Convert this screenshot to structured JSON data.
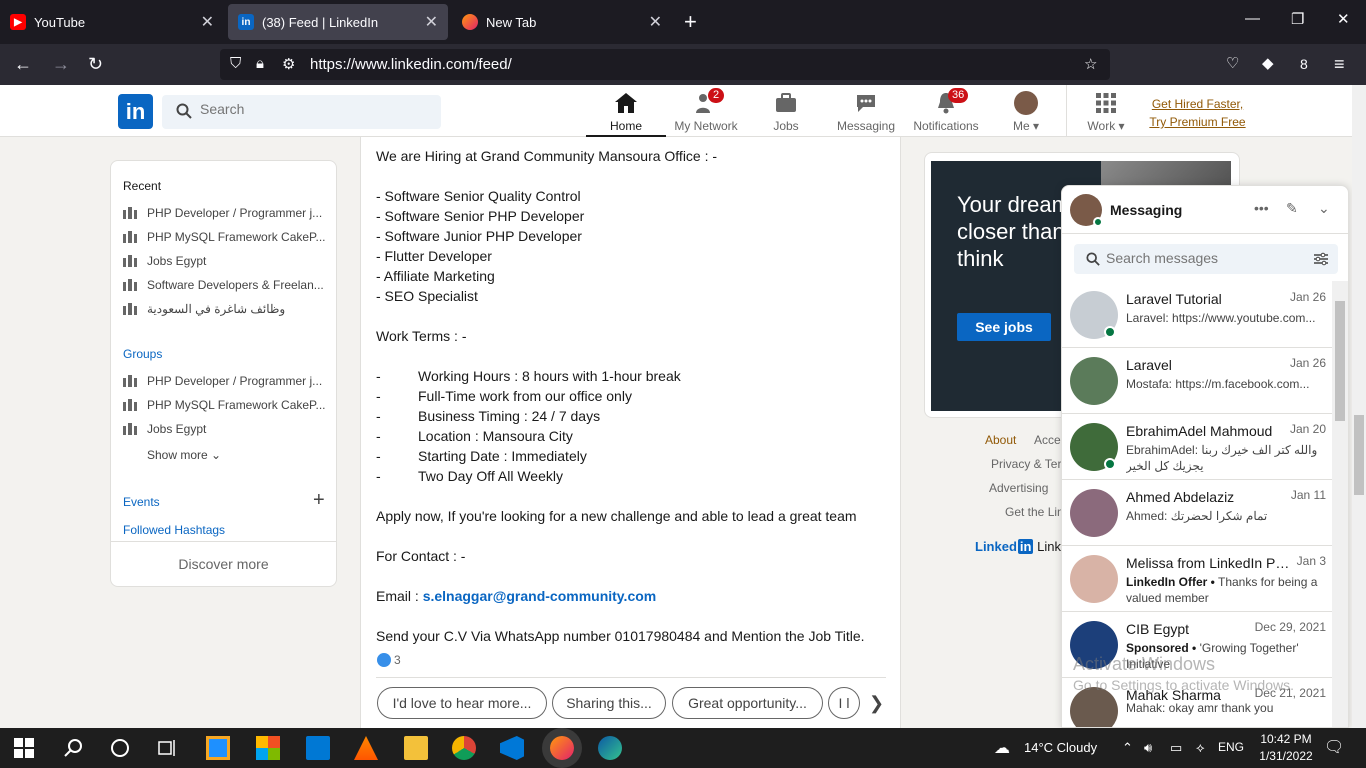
{
  "browser": {
    "tabs": [
      {
        "title": "YouTube"
      },
      {
        "title": "(38) Feed | LinkedIn"
      },
      {
        "title": "New Tab"
      }
    ],
    "new_tab_glyph": "+",
    "url": "https://www.linkedin.com/feed/",
    "ext_count": "8"
  },
  "header": {
    "search_placeholder": "Search",
    "nav": [
      {
        "label": "Home",
        "icon": "home-icon"
      },
      {
        "label": "My Network",
        "icon": "network-icon",
        "badge": "2"
      },
      {
        "label": "Jobs",
        "icon": "jobs-icon"
      },
      {
        "label": "Messaging",
        "icon": "messaging-icon"
      },
      {
        "label": "Notifications",
        "icon": "bell-icon",
        "badge": "36"
      },
      {
        "label": "Me",
        "icon": "avatar"
      },
      {
        "label": "Work",
        "icon": "grid-icon"
      }
    ],
    "premium_line1": "Get Hired Faster,",
    "premium_line2": "Try Premium Free"
  },
  "sidebar": {
    "recent_title": "Recent",
    "recent": [
      "PHP Developer / Programmer j...",
      "PHP MySQL Framework CakeP...",
      "Jobs Egypt",
      "Software Developers & Freelan...",
      "وظائف شاغرة في السعودية"
    ],
    "groups_title": "Groups",
    "groups": [
      "PHP Developer / Programmer j...",
      "PHP MySQL Framework CakeP...",
      "Jobs Egypt"
    ],
    "show_more": "Show more",
    "events": "Events",
    "hashtags": "Followed Hashtags",
    "discover": "Discover more"
  },
  "post": {
    "lines": [
      "We are Hiring at Grand Community Mansoura Office : -",
      "- Software Senior Quality Control",
      "- Software Senior PHP Developer",
      "- Software Junior PHP Developer",
      "- Flutter Developer",
      "- Affiliate Marketing",
      "- SEO Specialist",
      "Work Terms : -"
    ],
    "terms": [
      "Working Hours : 8 hours with 1-hour break",
      "Full-Time work from our office only",
      "Business Timing : 24 / 7 days",
      "Location : Mansoura City",
      "Starting Date : Immediately",
      "Two Day Off All Weekly"
    ],
    "term_dash": "-",
    "apply": "Apply now, If you're looking for a new challenge and able to lead a great team",
    "contact": "For Contact : -",
    "email_label": "Email : ",
    "email": "s.elnaggar@grand-community.com",
    "whatsapp": "Send your C.V Via WhatsApp number 01017980484 and Mention the Job Title.",
    "reactions": "3",
    "replies": [
      "I'd love to hear more...",
      "Sharing this...",
      "Great opportunity...",
      "I l"
    ]
  },
  "ad": {
    "headline": "Your dream job is closer than you think",
    "cta": "See jobs"
  },
  "footer": {
    "about": "About",
    "accessibility": "Acce",
    "privacy": "Privacy & Ter",
    "advertising": "Advertising",
    "get_app": "Get the Lin",
    "brand": "Linked",
    "brand_in": "in",
    "brand_tail": "Linke"
  },
  "messaging": {
    "title": "Messaging",
    "search_placeholder": "Search messages",
    "conversations": [
      {
        "name": "Laravel Tutorial",
        "date": "Jan 26",
        "preview": "Laravel: https://www.youtube.com...",
        "online": true
      },
      {
        "name": "Laravel",
        "date": "Jan 26",
        "preview": "Mostafa: https://m.facebook.com...",
        "online": false
      },
      {
        "name": "EbrahimAdel Mahmoud",
        "date": "Jan 20",
        "preview": "EbrahimAdel: والله كتر الف خيرك ربنا يجزيك كل الخير",
        "online": true
      },
      {
        "name": "Ahmed Abdelaziz",
        "date": "Jan 11",
        "preview": "Ahmed: تمام شكرا لحضرتك",
        "online": false
      },
      {
        "name": "Melissa from LinkedIn Pre...",
        "date": "Jan 3",
        "sponsor": "LinkedIn Offer •",
        "preview": "Thanks for being a valued member",
        "online": false
      },
      {
        "name": "CIB Egypt",
        "date": "Dec 29, 2021",
        "sponsor": "Sponsored •",
        "preview": "'Growing Together' Initiative",
        "online": false
      },
      {
        "name": "Mahak Sharma",
        "date": "Dec 21, 2021",
        "preview": "Mahak: okay amr  thank you",
        "online": false
      }
    ]
  },
  "watermark": {
    "line1": "Activate Windows",
    "line2": "Go to Settings to activate Windows."
  },
  "taskbar": {
    "weather": "14°C  Cloudy",
    "lang": "ENG",
    "time": "10:42 PM",
    "date": "1/31/2022"
  }
}
